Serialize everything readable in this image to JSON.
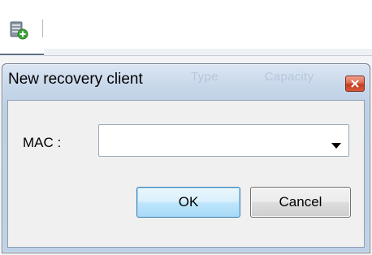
{
  "background_app": {
    "toolbar": {
      "icons": [
        {
          "icon": "add-server-icon",
          "colors": {
            "body": "#8a94a2",
            "badge": "#3ea53a"
          }
        }
      ]
    },
    "column_headers_faded": [
      "Type",
      "Capacity"
    ]
  },
  "dialog": {
    "title": "New recovery client",
    "close_icon": "close-icon",
    "colors": {
      "frame": "#c7d7ea",
      "close": "#d8573a",
      "client_area": "#f0f0f0"
    },
    "mac_field": {
      "label": "MAC :",
      "value": "",
      "dropdown_icon": "chevron-down-icon"
    },
    "buttons": {
      "ok_label": "OK",
      "cancel_label": "Cancel"
    }
  }
}
